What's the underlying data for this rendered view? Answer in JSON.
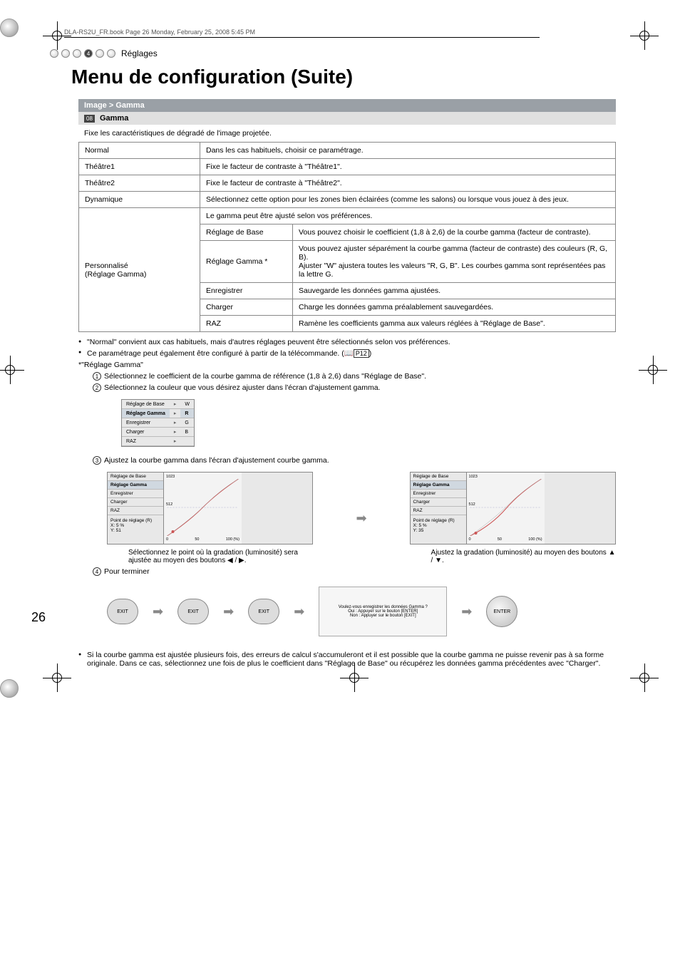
{
  "header_line": "DLA-RS2U_FR.book  Page 26  Monday, February 25, 2008  5:45 PM",
  "section_tag": {
    "number": "4",
    "label": "Réglages"
  },
  "title": "Menu de configuration (Suite)",
  "section_bar": "Image > Gamma",
  "sub_bar": {
    "tag": "08",
    "label": "Gamma"
  },
  "section_desc": "Fixe les caractéristiques de dégradé de l'image projetée.",
  "rows": {
    "normal": {
      "label": "Normal",
      "desc": "Dans les cas habituels, choisir ce paramétrage."
    },
    "theatre1": {
      "label": "Théâtre1",
      "desc": "Fixe le facteur de contraste à \"Théâtre1\"."
    },
    "theatre2": {
      "label": "Théâtre2",
      "desc": "Fixe le facteur de contraste à \"Théâtre2\"."
    },
    "dynamique": {
      "label": "Dynamique",
      "desc": "Sélectionnez cette option pour les zones bien éclairées (comme les salons) ou lorsque vous jouez à des jeux."
    },
    "perso": {
      "label_line1": "Personnalisé",
      "label_line2": "(Réglage Gamma)",
      "top_desc": "Le gamma peut être ajusté selon vos préférences.",
      "sub": {
        "base": {
          "label": "Réglage de Base",
          "desc": "Vous pouvez choisir le coefficient (1,8 à 2,6) de la courbe gamma (facteur de contraste)."
        },
        "gamma": {
          "label": "Réglage Gamma *",
          "desc": "Vous pouvez ajuster séparément la courbe gamma (facteur de contraste) des couleurs (R, G, B).\nAjuster \"W\" ajustera toutes les valeurs \"R, G, B\". Les courbes gamma sont représentées pas la lettre G."
        },
        "save": {
          "label": "Enregistrer",
          "desc": "Sauvegarde les données gamma ajustées."
        },
        "load": {
          "label": "Charger",
          "desc": "Charge les données gamma préalablement sauvegardées."
        },
        "reset": {
          "label": "RAZ",
          "desc": "Ramène les coefficients gamma aux valeurs réglées à \"Réglage de Base\"."
        }
      }
    }
  },
  "notes": {
    "n1": "\"Normal\" convient aux cas habituels, mais d'autres réglages peuvent être sélectionnés selon vos préférences.",
    "n2_pre": "Ce paramétrage peut également être configuré à partir de la télécommande. (",
    "n2_ref": "P12",
    "n2_post": ")"
  },
  "star": "*\"Réglage Gamma\"",
  "steps": {
    "s1": "Sélectionnez le coefficient de la courbe gamma de référence (1,8 à 2,6) dans \"Réglage de Base\".",
    "s2": "Sélectionnez la couleur que vous désirez ajuster dans l'écran d'ajustement gamma.",
    "s3": "Ajustez la courbe gamma dans l'écran d'ajustement courbe gamma.",
    "s4": "Pour terminer"
  },
  "ui_menu": {
    "base": "Réglage de Base",
    "gamma": "Réglage Gamma",
    "save": "Enregistrer",
    "load": "Charger",
    "reset": "RAZ",
    "colors": {
      "w": "W",
      "r": "R",
      "g": "G",
      "b": "B"
    }
  },
  "graph": {
    "ymax": "1023",
    "ymid": "512",
    "xmin": "0",
    "xmid": "50",
    "xmax": "100 (%)",
    "point_label": "Point de réglage (R)",
    "point_x_label": "X:",
    "point_x1": "5 %",
    "point_x2": "5 %",
    "point_y_label": "Y:",
    "point_y1": "51",
    "point_y2": "35",
    "caption_left": "Sélectionnez le point où la gradation (luminosité) sera ajustée au moyen des boutons ◀ / ▶.",
    "caption_right": "Ajustez la gradation (luminosité) au moyen des boutons ▲ / ▼."
  },
  "buttons": {
    "exit": "EXIT",
    "enter": "ENTER"
  },
  "save_dialog": {
    "line1": "Voulez-vous enregistrer les données Gamma ?",
    "line2": "Oui : Appuyer sur le bouton [ENTER]",
    "line3": "Non : Appuyer sur le bouton [EXIT]"
  },
  "final_note": "Si la courbe gamma est ajustée plusieurs fois, des erreurs de calcul s'accumuleront et il est possible que la courbe gamma ne puisse revenir pas à sa forme originale. Dans ce cas, sélectionnez une fois de plus le coefficient dans \"Réglage de Base\" ou récupérez les données gamma précédentes avec \"Charger\".",
  "page_number": "26"
}
